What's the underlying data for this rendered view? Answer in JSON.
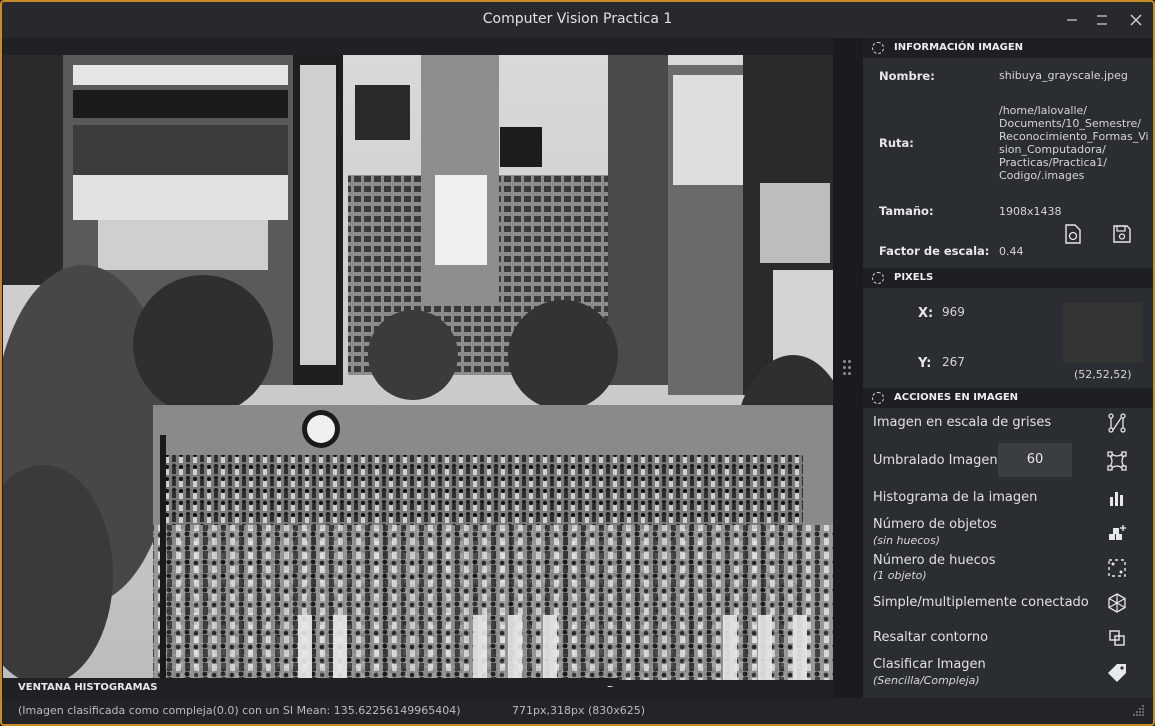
{
  "window": {
    "title": "Computer Vision Practica 1",
    "controls": [
      "minimize-icon",
      "maximize-icon",
      "close-icon"
    ]
  },
  "viewer": {
    "image_description_icon": "photo",
    "histogram_dock": {
      "label": "VENTANA HISTOGRAMAS",
      "button": "–"
    }
  },
  "info": {
    "header": "INFORMACIÓN IMAGEN",
    "name_label": "Nombre:",
    "name_value": "shibuya_grayscale.jpeg",
    "path_label": "Ruta:",
    "path_lines": [
      "/home/lalovalle/",
      "Documents/10_Semestre/",
      "Reconocimiento_Formas_Vi",
      "sion_Computadora/",
      "Practicas/Practica1/",
      "Codigo/.images"
    ],
    "size_label": "Tamaño:",
    "size_value": "1908x1438",
    "scale_label": "Factor de escala:",
    "scale_value": "0.44",
    "icons": [
      "file-reload-icon",
      "save-icon"
    ]
  },
  "pixels": {
    "header": "PIXELS",
    "x_label": "X:",
    "x_value": "969",
    "y_label": "Y:",
    "y_value": "267",
    "rgb": "(52,52,52)",
    "swatch_color": "#343434"
  },
  "actions": {
    "header": "ACCIONES EN IMAGEN",
    "grayscale": "Imagen en escala de grises",
    "threshold": "Umbralado Imagen",
    "threshold_value": "60",
    "histogram": "Histograma de la imagen",
    "objects": "Número de objetos",
    "objects_sub": "(sin huecos)",
    "holes": "Número de huecos",
    "holes_sub": "(1 objeto)",
    "connected": "Simple/multiplemente conectado",
    "contour": "Resaltar contorno",
    "classify": "Clasificar Imagen",
    "classify_sub": "(Sencilla/Compleja)"
  },
  "status": {
    "message": "(Imagen clasificada como compleja(0.0) con un SI Mean: 135.62256149965404)",
    "coords": "771px,318px (830x625)"
  },
  "colors": {
    "accent_border": "#c98a2a",
    "panel_bg": "#2a2d31",
    "header_bg": "#1d1f22"
  }
}
